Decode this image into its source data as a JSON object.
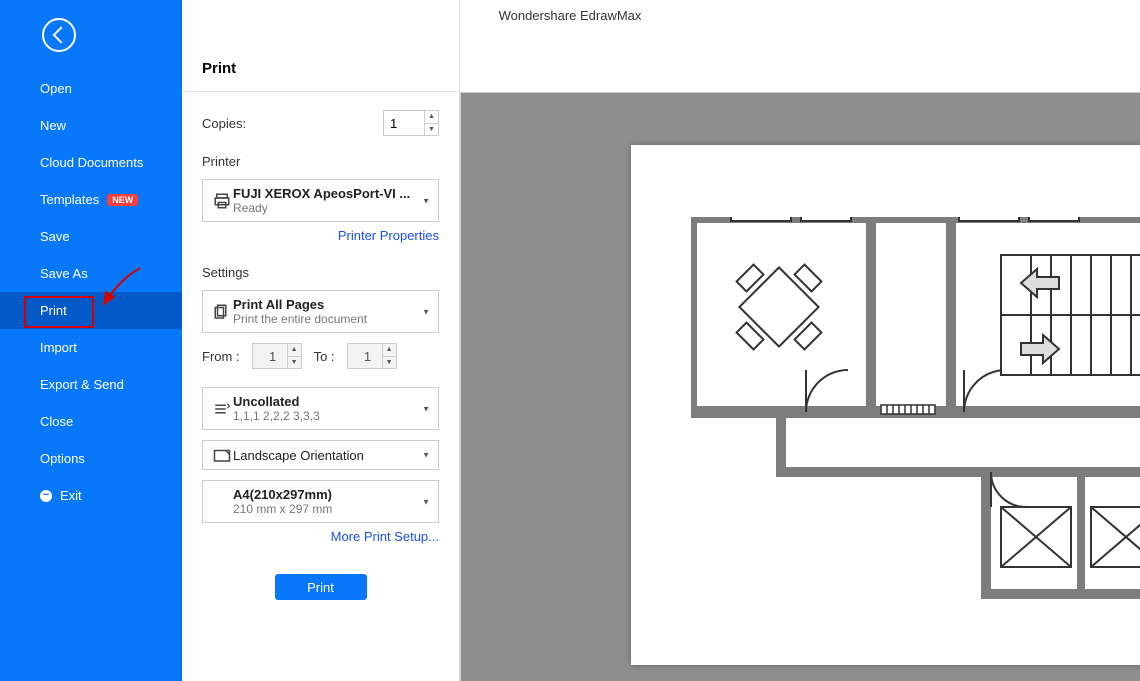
{
  "app": {
    "title": "Wondershare EdrawMax"
  },
  "sidebar": {
    "items": [
      {
        "label": "Open"
      },
      {
        "label": "New"
      },
      {
        "label": "Cloud Documents"
      },
      {
        "label": "Templates",
        "badge": "NEW"
      },
      {
        "label": "Save"
      },
      {
        "label": "Save As"
      },
      {
        "label": "Print",
        "active": true
      },
      {
        "label": "Import"
      },
      {
        "label": "Export & Send"
      },
      {
        "label": "Close"
      },
      {
        "label": "Options"
      },
      {
        "label": "Exit",
        "exit": true
      }
    ]
  },
  "panel": {
    "title": "Print",
    "copies_label": "Copies:",
    "copies_value": "1",
    "printer_label": "Printer",
    "printer_name": "FUJI XEROX ApeosPort-VI ...",
    "printer_status": "Ready",
    "printer_properties": "Printer Properties",
    "settings_label": "Settings",
    "pages_title": "Print All Pages",
    "pages_sub": "Print the entire document",
    "from_label": "From :",
    "from_value": "1",
    "to_label": "To :",
    "to_value": "1",
    "collate_title": "Uncollated",
    "collate_sub": "1,1,1  2,2,2  3,3,3",
    "orientation": "Landscape Orientation",
    "paper_title": "A4(210x297mm)",
    "paper_sub": "210 mm x 297 mm",
    "more_setup": "More Print Setup...",
    "print_button": "Print"
  }
}
